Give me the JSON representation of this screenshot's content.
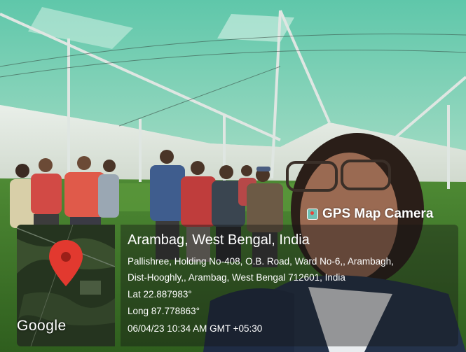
{
  "overlay": {
    "app_name": "GPS Map Camera",
    "location_title": "Arambag, West Bengal, India",
    "address_line_1": "Pallishree, Holding No-408, O.B. Road, Ward No-6,, Arambagh,",
    "address_line_2": "Dist-Hooghly,, Arambag, West Bengal 712601, India",
    "latitude": "Lat 22.887983°",
    "longitude": "Long 87.778863°",
    "timestamp": "06/04/23 10:34 AM GMT +05:30",
    "map_brand": "Google"
  },
  "colors": {
    "shade_net": "#4fb79a",
    "seedlings": "#3f7d2a",
    "pin": "#e2392f"
  }
}
